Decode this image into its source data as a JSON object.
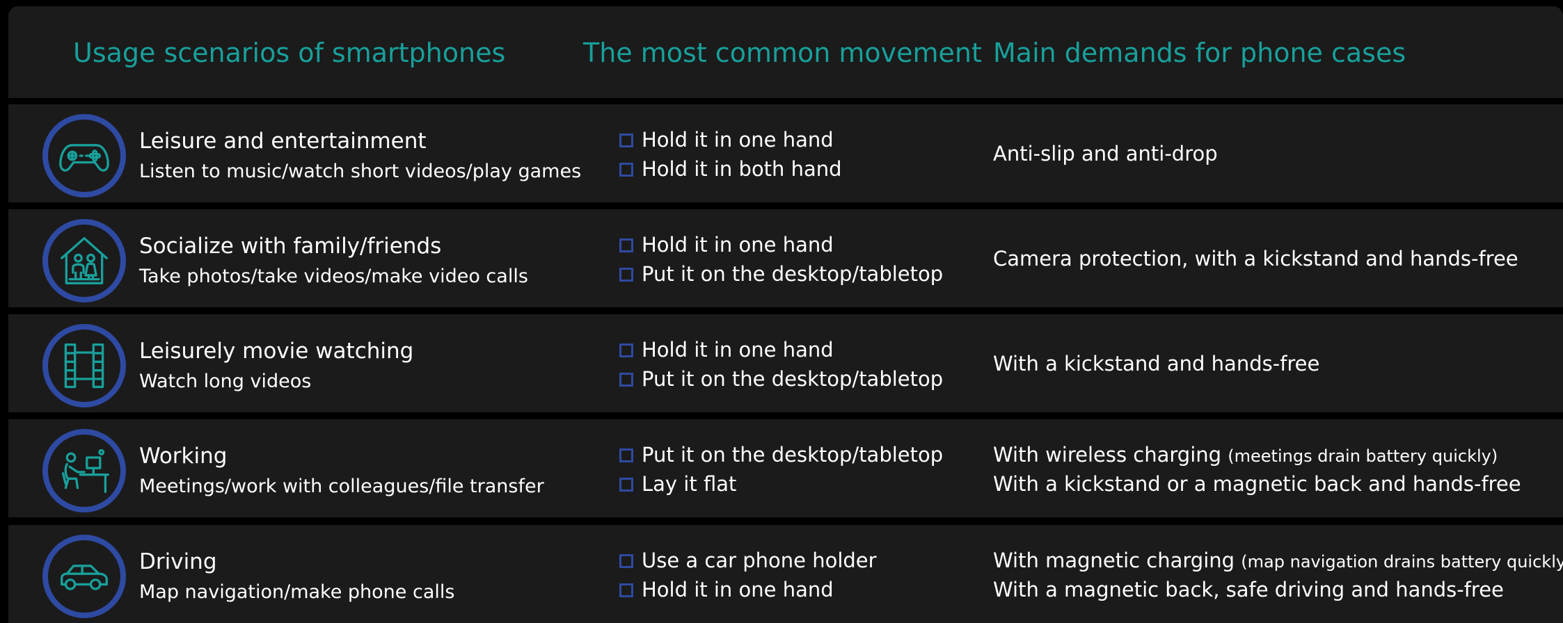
{
  "header": {
    "col1": "Usage scenarios of smartphones",
    "col2": "The most common movement",
    "col3": "Main demands for phone cases"
  },
  "colors": {
    "background": "#000000",
    "panel": "#1b1b1b",
    "accent_teal": "#18a09b",
    "icon_ring_blue": "#2e4aa2",
    "text": "#ffffff"
  },
  "rows": [
    {
      "icon": "gamepad-icon",
      "title": "Leisure and entertainment",
      "subtitle": "Listen to music/watch short videos/play games",
      "movements": [
        "Hold it in one hand",
        "Hold it in both hand"
      ],
      "demand_main": "Anti-slip and anti-drop"
    },
    {
      "icon": "family-home-icon",
      "title": "Socialize with family/friends",
      "subtitle": "Take photos/take videos/make video calls",
      "movements": [
        "Hold it in one hand",
        "Put it on the desktop/tabletop"
      ],
      "demand_main": "Camera protection, with a kickstand and hands-free"
    },
    {
      "icon": "film-strip-icon",
      "title": "Leisurely movie watching",
      "subtitle": "Watch long videos",
      "movements": [
        "Hold it in one hand",
        "Put it on the desktop/tabletop"
      ],
      "demand_main": "With a kickstand and hands-free"
    },
    {
      "icon": "person-at-desk-icon",
      "title": "Working",
      "subtitle": "Meetings/work with colleagues/file transfer",
      "movements": [
        "Put it on the desktop/tabletop",
        "Lay it flat"
      ],
      "demand_line1": "With wireless charging",
      "demand_line1_note": "(meetings drain battery quickly)",
      "demand_line2": "With a kickstand or a magnetic back and hands-free"
    },
    {
      "icon": "car-icon",
      "title": "Driving",
      "subtitle": "Map navigation/make phone calls",
      "movements": [
        "Use a car phone holder",
        "Hold it in one hand"
      ],
      "demand_line1": "With magnetic charging",
      "demand_line1_note": "(map navigation drains battery quickly)",
      "demand_line2": "With a magnetic back, safe driving and hands-free"
    }
  ]
}
